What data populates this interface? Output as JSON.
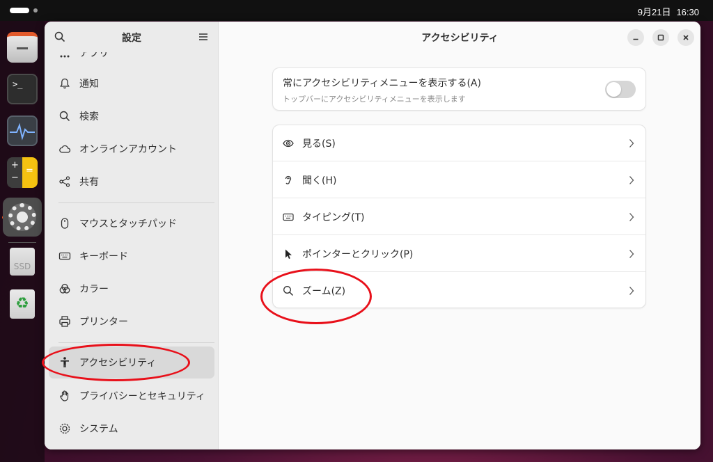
{
  "topbar": {
    "date": "9月21日",
    "time": "16:30"
  },
  "dock": {
    "apps": [
      "files-app",
      "terminal-app",
      "system-monitor-app",
      "calculator-app",
      "settings-app",
      "ssd-drive",
      "trash"
    ],
    "terminal_glyph": ">_",
    "ssd_label": "SSD"
  },
  "sidebar": {
    "title": "設定",
    "items": [
      {
        "label": "アプリ",
        "icon": "apps-icon"
      },
      {
        "label": "通知",
        "icon": "bell-icon"
      },
      {
        "label": "検索",
        "icon": "search-icon"
      },
      {
        "label": "オンラインアカウント",
        "icon": "cloud-icon"
      },
      {
        "label": "共有",
        "icon": "share-icon"
      },
      {
        "label": "マウスとタッチパッド",
        "icon": "mouse-icon"
      },
      {
        "label": "キーボード",
        "icon": "keyboard-icon"
      },
      {
        "label": "カラー",
        "icon": "color-icon"
      },
      {
        "label": "プリンター",
        "icon": "printer-icon"
      },
      {
        "label": "アクセシビリティ",
        "icon": "accessibility-icon",
        "active": true
      },
      {
        "label": "プライバシーとセキュリティ",
        "icon": "hand-icon"
      },
      {
        "label": "システム",
        "icon": "system-icon"
      }
    ]
  },
  "main": {
    "title": "アクセシビリティ",
    "toggle": {
      "title": "常にアクセシビリティメニューを表示する(A)",
      "subtitle": "トップバーにアクセシビリティメニューを表示します",
      "state": false
    },
    "rows": [
      {
        "label": "見る(S)",
        "icon": "eye-icon"
      },
      {
        "label": "聞く(H)",
        "icon": "ear-icon"
      },
      {
        "label": "タイピング(T)",
        "icon": "keyboard-icon"
      },
      {
        "label": "ポインターとクリック(P)",
        "icon": "pointer-icon"
      },
      {
        "label": "ズーム(Z)",
        "icon": "zoom-icon"
      }
    ]
  },
  "colors": {
    "annotation": "#e8101a",
    "accent": "#e95420"
  }
}
